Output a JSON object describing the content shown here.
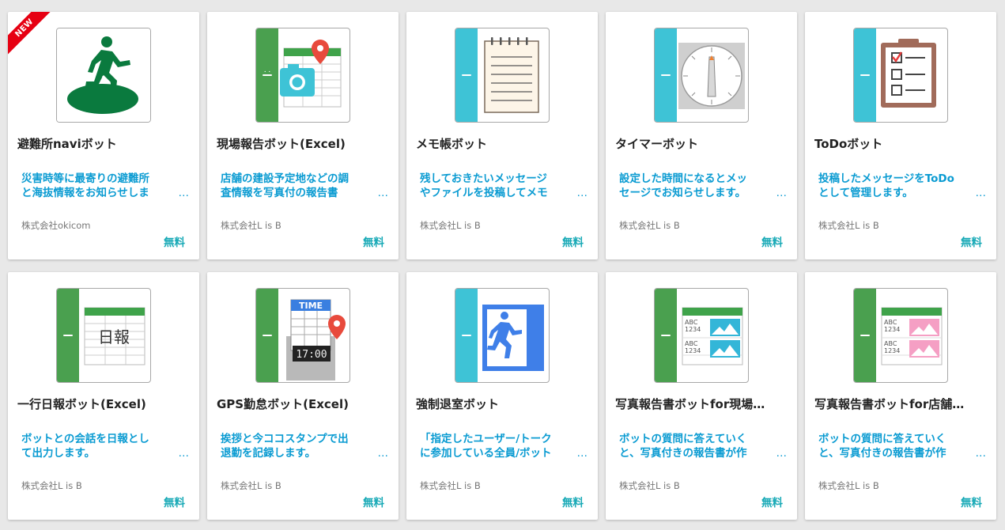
{
  "colors": {
    "background": "#e8e8e8",
    "description": "#0a9bd2",
    "price": "#17a9b6",
    "new_badge": "#e60012",
    "strip_green": "#4aa04f",
    "strip_teal": "#3ec3d6"
  },
  "new_badge": "NEW",
  "more_glyph": "…",
  "cards": [
    {
      "title": "避難所naviボット",
      "desc_line1": "災害時等に最寄りの避難所",
      "desc_line2": "と海抜情報をお知らせしま",
      "vendor": "株式会社okicom",
      "price": "無料",
      "icon": "evacuation-runner-icon"
    },
    {
      "title": "現場報告ボット(Excel)",
      "desc_line1": "店舗の建設予定地などの調",
      "desc_line2": "査情報を写真付の報告書",
      "vendor": "株式会社L is B",
      "price": "無料",
      "icon": "spreadsheet-camera-pin-icon"
    },
    {
      "title": "メモ帳ボット",
      "desc_line1": "残しておきたいメッセージ",
      "desc_line2": "やファイルを投稿してメモ",
      "vendor": "株式会社L is B",
      "price": "無料",
      "icon": "notepad-icon"
    },
    {
      "title": "タイマーボット",
      "desc_line1": "設定した時間になるとメッ",
      "desc_line2": "セージでお知らせします。",
      "vendor": "株式会社L is B",
      "price": "無料",
      "icon": "timer-dial-icon"
    },
    {
      "title": "ToDoボット",
      "desc_line1": "投稿したメッセージをToDo",
      "desc_line2": "として管理します。",
      "vendor": "株式会社L is B",
      "price": "無料",
      "icon": "checklist-clipboard-icon"
    },
    {
      "title": "一行日報ボット(Excel)",
      "desc_line1": "ボットとの会話を日報とし",
      "desc_line2": "て出力します。",
      "vendor": "株式会社L is B",
      "price": "無料",
      "icon": "daily-report-sheet-icon",
      "icon_text": "日報"
    },
    {
      "title": "GPS勤怠ボット(Excel)",
      "desc_line1": "挨拶と今ココスタンプで出",
      "desc_line2": "退勤を記録します。",
      "vendor": "株式会社L is B",
      "price": "無料",
      "icon": "time-clock-icon",
      "icon_text": "TIME",
      "icon_text2": "17:00"
    },
    {
      "title": "強制退室ボット",
      "desc_line1": "「指定したユーザー/トーク",
      "desc_line2": "に参加している全員/ボット",
      "vendor": "株式会社L is B",
      "price": "無料",
      "icon": "exit-door-icon"
    },
    {
      "title": "写真報告書ボットfor現場…",
      "desc_line1": "ボットの質問に答えていく",
      "desc_line2": "と、写真付きの報告書が作",
      "vendor": "株式会社L is B",
      "price": "無料",
      "icon": "photo-report-blue-icon",
      "icon_text": "ABC",
      "icon_text2": "1234"
    },
    {
      "title": "写真報告書ボットfor店舗…",
      "desc_line1": "ボットの質問に答えていく",
      "desc_line2": "と、写真付きの報告書が作",
      "vendor": "株式会社L is B",
      "price": "無料",
      "icon": "photo-report-pink-icon",
      "icon_text": "ABC",
      "icon_text2": "1234"
    }
  ]
}
